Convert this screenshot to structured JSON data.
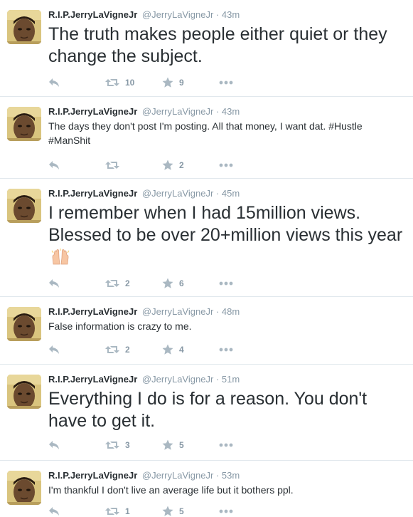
{
  "colors": {
    "icon": "#aab8c2",
    "meta": "#8899a6",
    "text": "#292f33",
    "avatar_bg": "#d8c27a"
  },
  "tweets": [
    {
      "fullname": "R.I.P.JerryLaVigneJr",
      "handle": "@JerryLaVigneJr",
      "sep": "·",
      "time": "43m",
      "text": "The truth makes people either quiet or they change the subject.",
      "retweets": "10",
      "favorites": "9"
    },
    {
      "fullname": "R.I.P.JerryLaVigneJr",
      "handle": "@JerryLaVigneJr",
      "sep": "·",
      "time": "43m",
      "text": "The days they don't post I'm posting. All that money, I want dat.",
      "hashtags": [
        "#Hustle",
        "#ManShit"
      ],
      "retweets": "",
      "favorites": "2"
    },
    {
      "fullname": "R.I.P.JerryLaVigneJr",
      "handle": "@JerryLaVigneJr",
      "sep": "·",
      "time": "45m",
      "text": "I remember when I had 15million views. Blessed to be over 20+million views this year",
      "emoji": "raised-hands-emoji",
      "retweets": "2",
      "favorites": "6"
    },
    {
      "fullname": "R.I.P.JerryLaVigneJr",
      "handle": "@JerryLaVigneJr",
      "sep": "·",
      "time": "48m",
      "text": "False information is crazy to me.",
      "retweets": "2",
      "favorites": "4"
    },
    {
      "fullname": "R.I.P.JerryLaVigneJr",
      "handle": "@JerryLaVigneJr",
      "sep": "·",
      "time": "51m",
      "text": "Everything I do is for a reason. You don't have to get it.",
      "retweets": "3",
      "favorites": "5"
    },
    {
      "fullname": "R.I.P.JerryLaVigneJr",
      "handle": "@JerryLaVigneJr",
      "sep": "·",
      "time": "53m",
      "text": "I'm thankful I don't live an average life but it bothers ppl.",
      "retweets": "1",
      "favorites": "5"
    }
  ]
}
